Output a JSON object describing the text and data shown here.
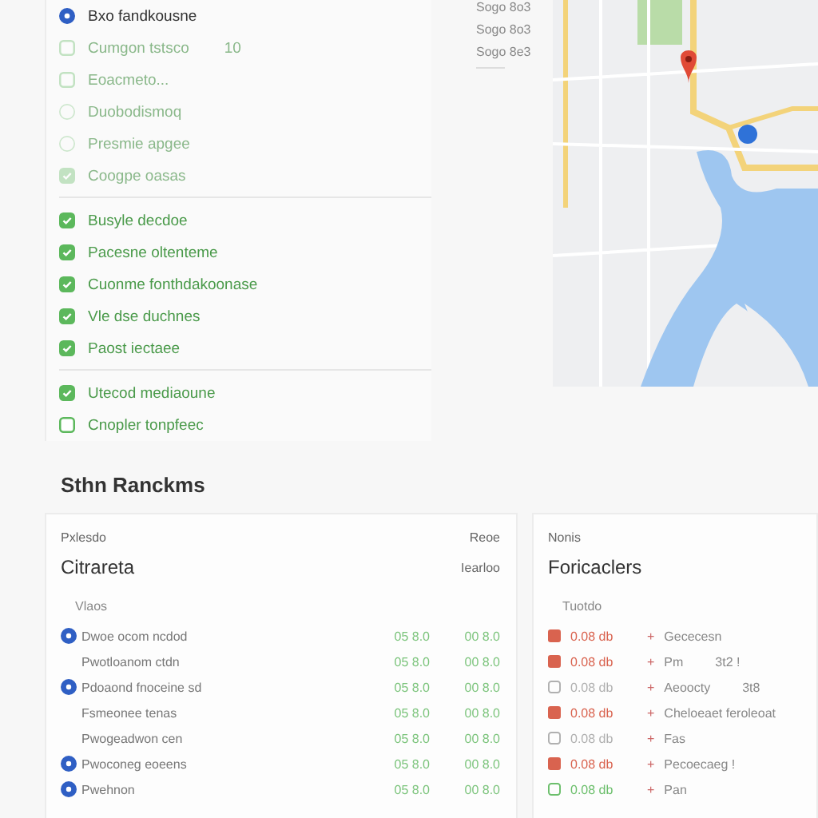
{
  "filters": {
    "groups": [
      {
        "items": [
          {
            "label": "Bxo fandkousne",
            "kind": "radio",
            "checked": true,
            "disabled": false
          },
          {
            "label": "Cumgon tstsco",
            "kind": "checkbox",
            "checked": false,
            "disabled": true,
            "count": "10"
          },
          {
            "label": "Eoacmeto...",
            "kind": "checkbox",
            "checked": false,
            "disabled": true
          },
          {
            "label": "Duobodismoq",
            "kind": "radio",
            "checked": false,
            "disabled": true
          },
          {
            "label": "Presmie apgee",
            "kind": "radio",
            "checked": false,
            "disabled": true
          },
          {
            "label": "Coogpe oasas",
            "kind": "checkbox",
            "checked": true,
            "disabled": true
          }
        ]
      },
      {
        "items": [
          {
            "label": "Busyle decdoe",
            "kind": "checkbox",
            "checked": true,
            "disabled": false
          },
          {
            "label": "Pacesne oltenteme",
            "kind": "checkbox",
            "checked": true,
            "disabled": false
          },
          {
            "label": "Cuonme fonthdakoonase",
            "kind": "checkbox",
            "checked": true,
            "disabled": false
          },
          {
            "label": "Vle dse duchnes",
            "kind": "checkbox",
            "checked": true,
            "disabled": false
          },
          {
            "label": "Paost iectaee",
            "kind": "checkbox",
            "checked": true,
            "disabled": false
          }
        ]
      },
      {
        "items": [
          {
            "label": "Utecod mediaoune",
            "kind": "checkbox",
            "checked": true,
            "disabled": false
          },
          {
            "label": "Cnopler tonpfeec",
            "kind": "checkbox",
            "checked": false,
            "disabled": false
          }
        ]
      }
    ]
  },
  "side_notes": [
    "Sogo 8o3",
    "Sogo 8o3",
    "Sogo 8e3"
  ],
  "section_title": "Sthn Ranckms",
  "cards": [
    {
      "label": "Pxlesdo",
      "label_right": "Reoe",
      "title": "Citrareta",
      "title_right": "Iearloo",
      "subheading": "Vlaos",
      "kind": "values",
      "rows": [
        {
          "icon": true,
          "text": "Dwoe ocom ncdod",
          "value_1": "05 8.0",
          "value_2": "00 8.0"
        },
        {
          "icon": false,
          "text": "Pwotloanom ctdn",
          "value_1": "05 8.0",
          "value_2": "00 8.0"
        },
        {
          "icon": true,
          "text": "Pdoaond fnoceine sd",
          "value_1": "05 8.0",
          "value_2": "00 8.0"
        },
        {
          "icon": false,
          "text": "Fsmeonee tenas",
          "value_1": "05 8.0",
          "value_2": "00 8.0"
        },
        {
          "icon": false,
          "text": "Pwogeadwon cen",
          "value_1": "05 8.0",
          "value_2": "00 8.0"
        },
        {
          "icon": true,
          "text": "Pwoconeg eoeens",
          "value_1": "05 8.0",
          "value_2": "00 8.0"
        },
        {
          "icon": true,
          "text": "Pwehnon",
          "value_1": "05 8.0",
          "value_2": "00 8.0"
        }
      ]
    },
    {
      "label": "Nonis",
      "title": "Foricaclers",
      "subheading": "Tuotdo",
      "kind": "status",
      "rows": [
        {
          "color": "#d9634f",
          "filled": true,
          "code": "0.08 db",
          "sign": "+",
          "text": "Gececesn"
        },
        {
          "color": "#d9634f",
          "filled": true,
          "code": "0.08 db",
          "sign": "+",
          "text": "Pm",
          "note": "3t2 !"
        },
        {
          "color": "#b0b0b0",
          "filled": false,
          "code": "0.08 db",
          "sign": "+",
          "text": "Aeoocty",
          "note": "3t8"
        },
        {
          "color": "#d9634f",
          "filled": true,
          "code": "0.08 db",
          "sign": "+",
          "text": "Cheloeaet feroleoat"
        },
        {
          "color": "#b0b0b0",
          "filled": false,
          "code": "0.08 db",
          "sign": "+",
          "text": "Fas"
        },
        {
          "color": "#d9634f",
          "filled": true,
          "code": "0.08 db",
          "sign": "+",
          "text": "Pecoecaeg !"
        },
        {
          "color": "#6cbf6c",
          "filled": false,
          "code": "0.08 db",
          "sign": "+",
          "text": "Pan"
        }
      ]
    }
  ]
}
